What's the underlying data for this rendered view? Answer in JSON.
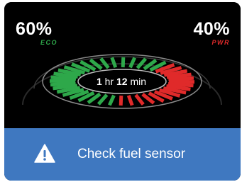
{
  "eco": {
    "percent": "60%",
    "label": "ECO",
    "color": "#2ea84a"
  },
  "pwr": {
    "percent": "40%",
    "label": "PWR",
    "color": "#e02a2a"
  },
  "gauge": {
    "eco_fraction": 0.6,
    "hours": "1",
    "hours_unit": "hr",
    "minutes": "12",
    "minutes_unit": "min"
  },
  "alert": {
    "icon": "warning-icon",
    "message": "Check fuel sensor",
    "background": "#3f78c0"
  }
}
